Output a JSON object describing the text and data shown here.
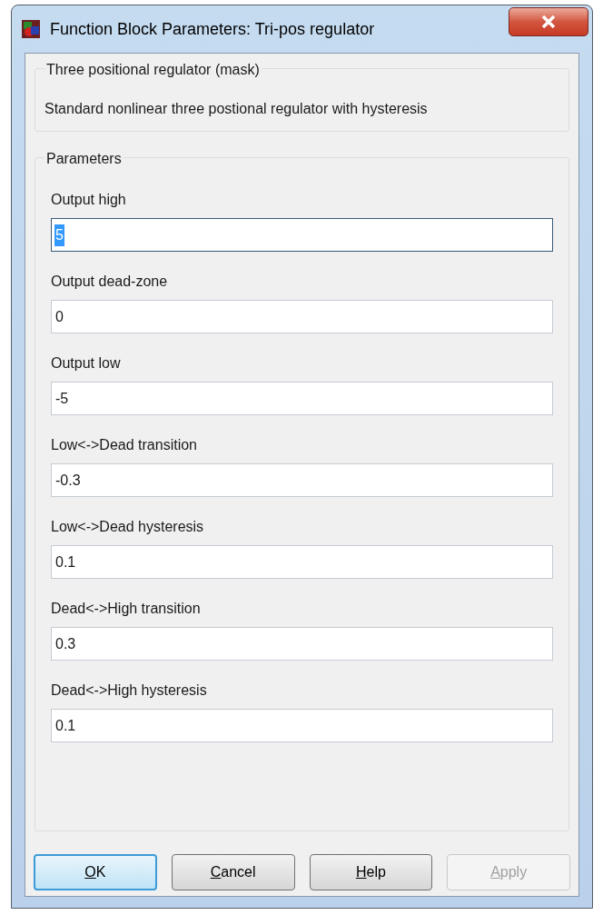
{
  "window": {
    "title": "Function Block Parameters: Tri-pos regulator"
  },
  "description_group": {
    "title": "Three positional regulator (mask)",
    "text": "Standard nonlinear three postional regulator with hysteresis"
  },
  "parameters_group": {
    "title": "Parameters",
    "fields": [
      {
        "label": "Output high",
        "value": "5",
        "value_selected": true
      },
      {
        "label": "Output dead-zone",
        "value": "0",
        "value_selected": false
      },
      {
        "label": "Output low",
        "value": "-5",
        "value_selected": false
      },
      {
        "label": "Low<->Dead transition",
        "value": "-0.3",
        "value_selected": false
      },
      {
        "label": "Low<->Dead hysteresis",
        "value": "0.1",
        "value_selected": false
      },
      {
        "label": "Dead<->High transition",
        "value": "0.3",
        "value_selected": false
      },
      {
        "label": "Dead<->High hysteresis",
        "value": "0.1",
        "value_selected": false
      }
    ]
  },
  "buttons": [
    {
      "label": "OK",
      "default": true,
      "disabled": false
    },
    {
      "label": "Cancel",
      "default": false,
      "disabled": false
    },
    {
      "label": "Help",
      "default": false,
      "disabled": false
    },
    {
      "label": "Apply",
      "default": false,
      "disabled": true
    }
  ]
}
